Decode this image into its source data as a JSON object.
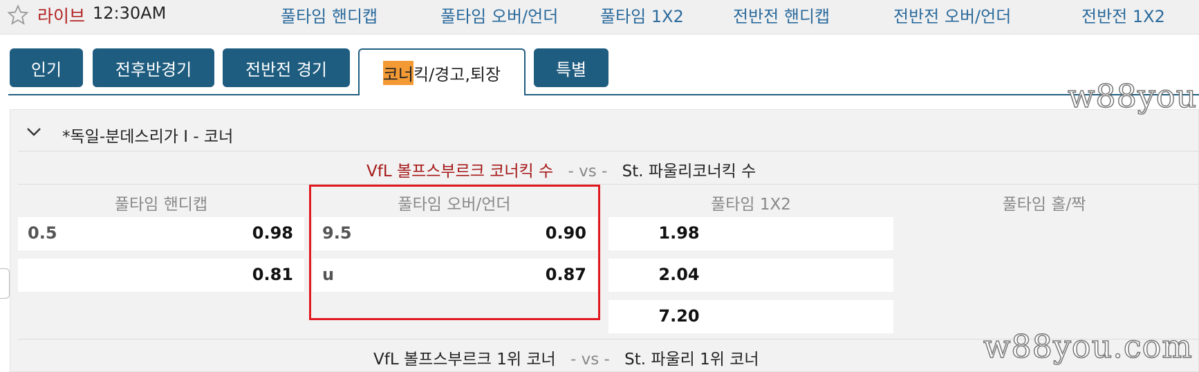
{
  "header": {
    "live_label": "라이브",
    "time": "12:30AM",
    "markets": [
      "풀타임 핸디캡",
      "풀타임 오버/언더",
      "풀타임 1X2",
      "전반전 핸디캡",
      "전반전 오버/언더",
      "전반전 1X2"
    ]
  },
  "tabs": [
    {
      "label": "인기"
    },
    {
      "label": "전후반경기"
    },
    {
      "label": "전반전 경기"
    },
    {
      "label_highlight": "코너",
      "label_rest": "킥/경고,퇴장",
      "active": true
    },
    {
      "label": "특별"
    }
  ],
  "watermarks": [
    "w88you.",
    "w88you.com"
  ],
  "league": {
    "title": "*독일-분데스리가 I - 코너"
  },
  "matches": [
    {
      "home": "VfL 볼프스부르크 코너킥 수",
      "vs": "- vs -",
      "away": "St. 파울리코너킥 수"
    },
    {
      "home": "VfL 볼프스부르크 1위 코너",
      "vs": "- vs -",
      "away": "St. 파울리 1위 코너"
    }
  ],
  "market_headers": [
    "풀타임 핸디캡",
    "풀타임 오버/언더",
    "풀타임 1X2",
    "풀타임 홀/짝"
  ],
  "odds": {
    "handicap": [
      {
        "line": "0.5",
        "price": "0.98"
      },
      {
        "line": "",
        "price": "0.81"
      }
    ],
    "over_under": [
      {
        "line": "9.5",
        "price": "0.90"
      },
      {
        "line": "u",
        "price": "0.87"
      }
    ],
    "x12": [
      "1.98",
      "2.04",
      "7.20"
    ]
  },
  "colors": {
    "tab_bg": "#1f5d80",
    "live": "#b22222",
    "home_team": "#a51818",
    "highlight": "#f39a34",
    "red_box": "#e0191f",
    "market_link": "#2a6a9c"
  }
}
